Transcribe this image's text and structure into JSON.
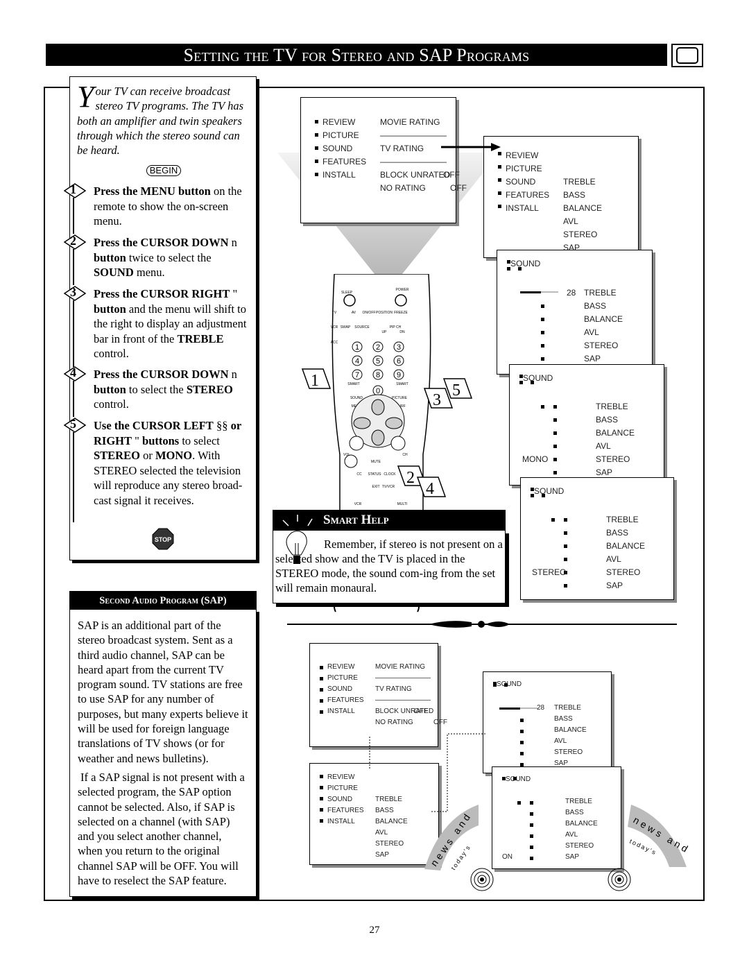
{
  "title": "Setting the TV for Stereo and SAP Programs",
  "intro": {
    "dropcap": "Y",
    "text": "our TV can receive broadcast stereo TV programs.  The TV has both an amplifier and twin speakers through which the stereo sound can be heard.",
    "begin": "BEGIN"
  },
  "steps": [
    {
      "num": "1",
      "segments": [
        {
          "t": "Press the MENU button",
          "b": true
        },
        {
          "t": " on the remote to show the on-screen menu."
        }
      ]
    },
    {
      "num": "2",
      "segments": [
        {
          "t": "Press the CURSOR DOWN",
          "b": true
        },
        {
          "t": " n  "
        },
        {
          "t": "button",
          "b": true
        },
        {
          "t": " twice to select the "
        },
        {
          "t": "SOUND",
          "b": true
        },
        {
          "t": " menu."
        }
      ]
    },
    {
      "num": "3",
      "segments": [
        {
          "t": "Press the CURSOR RIGHT",
          "b": true
        },
        {
          "t": " \"      "
        },
        {
          "t": "button",
          "b": true
        },
        {
          "t": " and the menu will shift to the right to display an adjustment bar in front of the "
        },
        {
          "t": "TREBLE",
          "b": true
        },
        {
          "t": " control."
        }
      ]
    },
    {
      "num": "4",
      "segments": [
        {
          "t": "Press the CURSOR DOWN",
          "b": true
        },
        {
          "t": " n  "
        },
        {
          "t": "button",
          "b": true
        },
        {
          "t": " to select the "
        },
        {
          "t": "STEREO",
          "b": true
        },
        {
          "t": " control."
        }
      ]
    },
    {
      "num": "5",
      "segments": [
        {
          "t": "Use the CURSOR LEFT",
          "b": true
        },
        {
          "t": " §§ "
        },
        {
          "t": "or RIGHT",
          "b": true
        },
        {
          "t": " \"      "
        },
        {
          "t": "buttons",
          "b": true
        },
        {
          "t": " to select "
        },
        {
          "t": "STEREO",
          "b": true
        },
        {
          "t": " or "
        },
        {
          "t": "MONO",
          "b": true
        },
        {
          "t": ". With STEREO selected the television will reproduce any stereo broad-cast signal it receives."
        }
      ]
    }
  ],
  "stop_label": "STOP",
  "sap": {
    "heading": "Second Audio Program (SAP)",
    "paragraphs": [
      "SAP is an additional part of the stereo broadcast system. Sent as a third audio channel, SAP can be heard apart from the current TV program sound. TV stations are free to use SAP for any number of purposes, but many experts believe it will be used for foreign language translations of TV shows (or for weather and news bulletins).",
      "If a SAP signal is not present with a selected program, the SAP option cannot be selected. Also, if SAP is selected on a channel (with SAP) and you select another channel, when you return to the original channel SAP will be OFF. You will have to reselect the SAP feature."
    ]
  },
  "smart_help": {
    "heading": "Smart Help",
    "text": "Remember, if stereo is not present on a selected show and the TV is placed in the STEREO mode, the sound com-ing from the set will remain monaural."
  },
  "menus": {
    "main": {
      "left": [
        "REVIEW",
        "PICTURE",
        "SOUND",
        "FEATURES",
        "INSTALL"
      ],
      "right": [
        "MOVIE RATING",
        "————————",
        "TV RATING",
        "————————",
        "BLOCK UNRATED",
        "NO RATING"
      ],
      "values": [
        "OFF",
        "OFF"
      ]
    },
    "sound_selected": {
      "left": [
        "REVIEW",
        "PICTURE",
        "SOUND",
        "FEATURES",
        "INSTALL"
      ],
      "right": [
        "TREBLE",
        "BASS",
        "BALANCE",
        "AVL",
        "STEREO",
        "SAP"
      ]
    },
    "treble": {
      "header": "SOUND",
      "value": "28",
      "items": [
        "TREBLE",
        "BASS",
        "BALANCE",
        "AVL",
        "STEREO",
        "SAP"
      ]
    },
    "stereo_mono": {
      "header": "SOUND",
      "setting": "MONO",
      "items": [
        "TREBLE",
        "BASS",
        "BALANCE",
        "AVL",
        "STEREO",
        "SAP"
      ]
    },
    "stereo_stereo": {
      "header": "SOUND",
      "setting": "STEREO",
      "items": [
        "TREBLE",
        "BASS",
        "BALANCE",
        "AVL",
        "STEREO",
        "SAP"
      ]
    },
    "sap_on": {
      "header": "SOUND",
      "setting": "ON",
      "items": [
        "TREBLE",
        "BASS",
        "BALANCE",
        "AVL",
        "STEREO",
        "SAP"
      ]
    }
  },
  "remote": {
    "labels": [
      "SLEEP",
      "POWER",
      "TV",
      "AV",
      "ON/OFF",
      "POSITION",
      "FREEZE",
      "VCR",
      "SWAP",
      "SOURCE",
      "PIP CH",
      "UP",
      "DN",
      "ACC",
      "SMART",
      "SMART",
      "SOUND",
      "PICTURE",
      "MENU",
      "SURF",
      "VOL",
      "CH",
      "MUTE",
      "CC",
      "STATUS",
      "CLOCK",
      "EXIT",
      "TV/VCR",
      "VCR",
      "MULTI"
    ],
    "digits": [
      "1",
      "2",
      "3",
      "4",
      "5",
      "6",
      "7",
      "8",
      "9",
      "0"
    ]
  },
  "callouts": [
    "1",
    "2",
    "3",
    "4",
    "5"
  ],
  "decor": {
    "text1": "news and",
    "text2": "today's"
  },
  "page_number": "27"
}
